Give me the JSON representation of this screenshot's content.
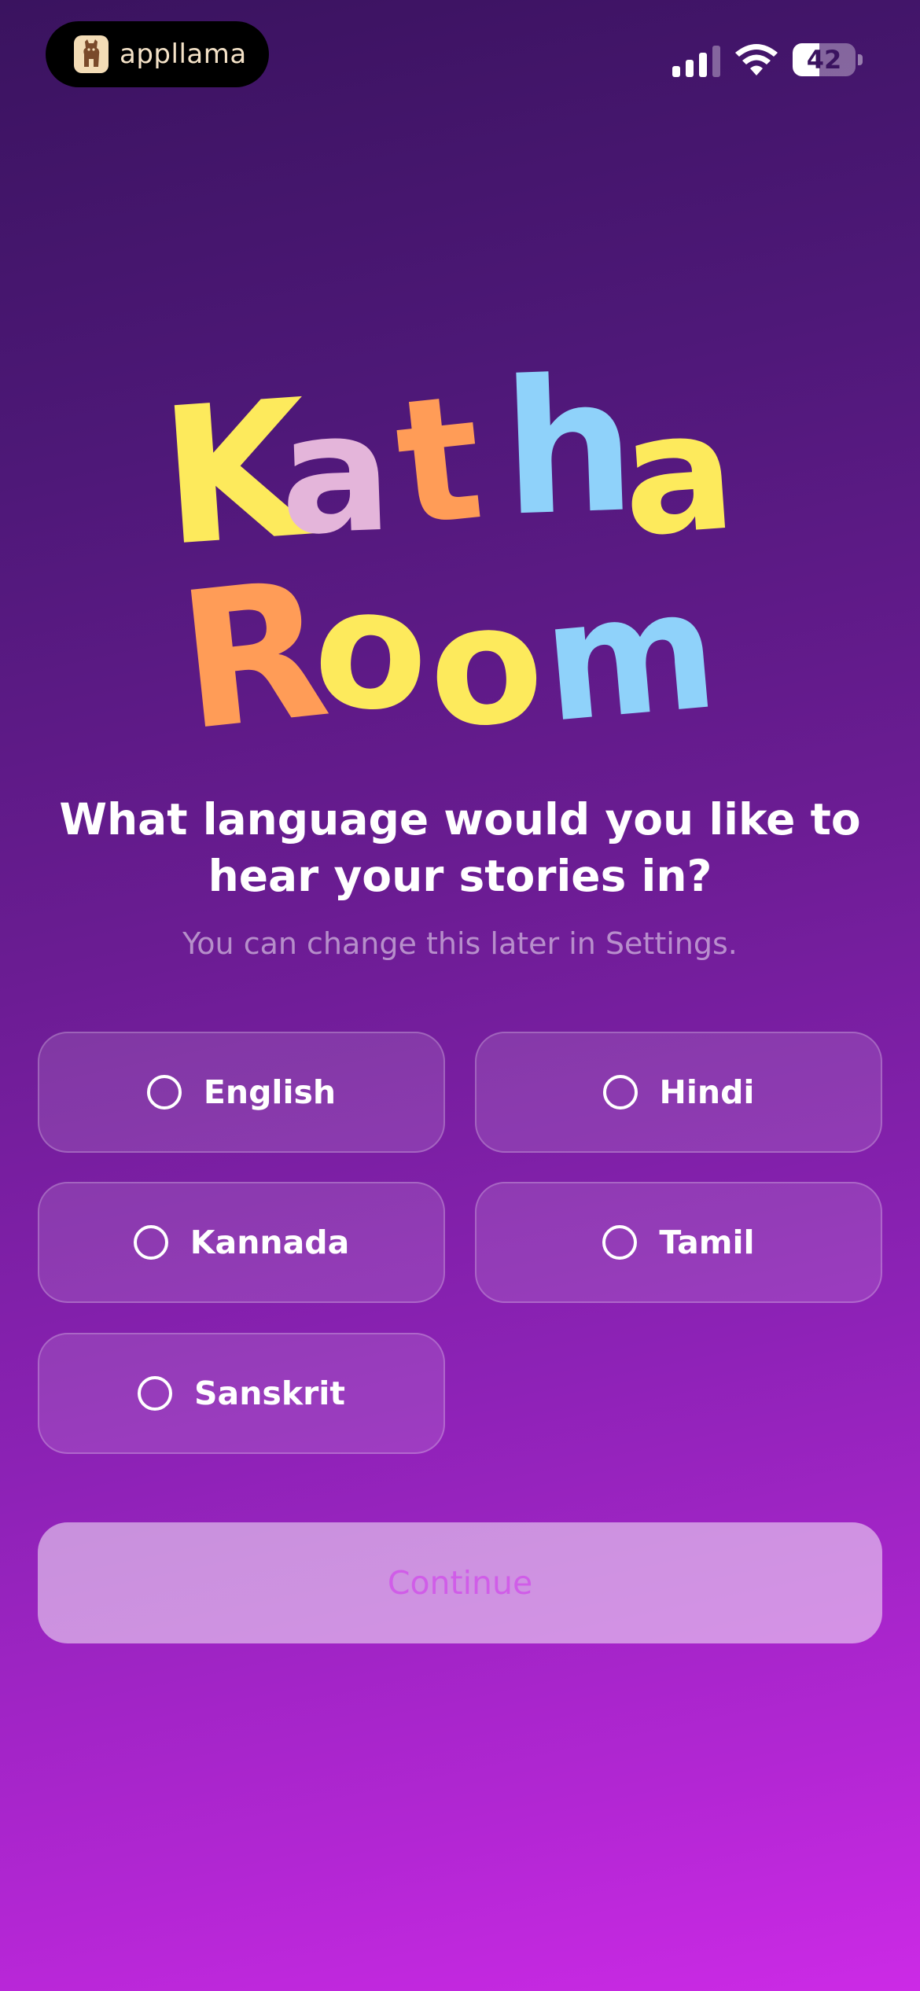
{
  "status_bar": {
    "brand_name": "appllama",
    "battery_level": "42",
    "battery_fraction": 0.42,
    "icons": [
      "llama-logo-icon",
      "cellular-signal-icon",
      "wifi-icon",
      "battery-icon"
    ]
  },
  "logo": {
    "line1": [
      "K",
      "a",
      "t",
      "h",
      "a"
    ],
    "line2": [
      "R",
      "o",
      "o",
      "m"
    ],
    "line1_colors": [
      "#fdea5c",
      "#e4b5da",
      "#ff9c57",
      "#8fd2fa",
      "#fdea5c"
    ],
    "line2_colors": [
      "#ff9c57",
      "#fdea5c",
      "#fdea5c",
      "#8fd2fa"
    ]
  },
  "onboarding": {
    "question": "What language would you like to hear your stories in?",
    "hint": "You can change this later in Settings."
  },
  "languages": [
    {
      "label": "English",
      "selected": false
    },
    {
      "label": "Hindi",
      "selected": false
    },
    {
      "label": "Kannada",
      "selected": false
    },
    {
      "label": "Tamil",
      "selected": false
    },
    {
      "label": "Sanskrit",
      "selected": false
    }
  ],
  "continue_button": {
    "label": "Continue",
    "enabled": false
  },
  "colors": {
    "background_top": "#3a135f",
    "background_bottom": "#cc2ae6",
    "continue_text": "#d05de8"
  }
}
